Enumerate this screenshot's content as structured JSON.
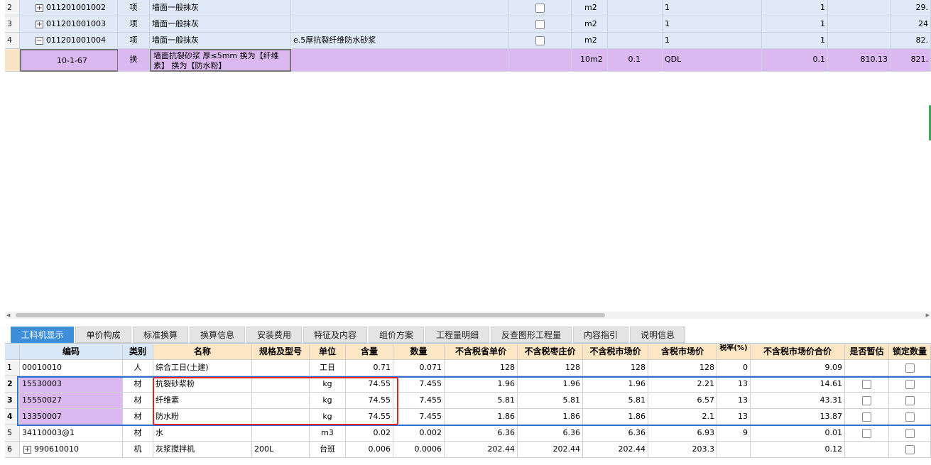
{
  "upper_grid": {
    "rows": [
      {
        "num": "2",
        "code": "011201001002",
        "type": "项",
        "name": "墙面一般抹灰",
        "feature": "",
        "unit": "m2",
        "qty_expr": "",
        "expr": "1",
        "qty": "1",
        "price": "",
        "total": "29."
      },
      {
        "num": "3",
        "code": "011201001003",
        "type": "项",
        "name": "墙面一般抹灰",
        "feature": "",
        "unit": "m2",
        "qty_expr": "",
        "expr": "1",
        "qty": "1",
        "price": "",
        "total": "24"
      },
      {
        "num": "4",
        "code": "011201001004",
        "type": "项",
        "name": "墙面一般抹灰",
        "feature": "e.5厚抗裂纤维防水砂浆",
        "unit": "m2",
        "qty_expr": "",
        "expr": "1",
        "qty": "1",
        "price": "",
        "total": "82."
      }
    ],
    "sub_row": {
      "code": "10-1-67",
      "type": "换",
      "name_line1": "墙面抗裂砂浆 厚≤5mm  换为【纤维",
      "name_line2": "素】 换为【防水粉】",
      "unit": "10m2",
      "qty_expr": "0.1",
      "expr": "QDL",
      "qty": "0.1",
      "price": "810.13",
      "total": "821."
    }
  },
  "tabs": [
    "工料机显示",
    "单价构成",
    "标准换算",
    "换算信息",
    "安装费用",
    "特征及内容",
    "组价方案",
    "工程量明细",
    "反查图形工程量",
    "内容指引",
    "说明信息"
  ],
  "lower_grid": {
    "headers": [
      "编码",
      "类别",
      "名称",
      "规格及型号",
      "单位",
      "含量",
      "数量",
      "不含税省单价",
      "不含税枣庄价",
      "不含税市场价",
      "含税市场价",
      "税率(%)",
      "不含税市场价合价",
      "是否暂估",
      "锁定数量"
    ],
    "rows": [
      {
        "num": "1",
        "code": "00010010",
        "type": "人",
        "name": "综合工日(土建)",
        "spec": "",
        "unit": "工日",
        "content": "0.71",
        "qty": "0.071",
        "p1": "128",
        "p2": "128",
        "p3": "128",
        "p4": "128",
        "tax": "0",
        "sum": "9.09"
      },
      {
        "num": "2",
        "code": "15530003",
        "type": "材",
        "name": "抗裂砂浆粉",
        "spec": "",
        "unit": "kg",
        "content": "74.55",
        "qty": "7.455",
        "p1": "1.96",
        "p2": "1.96",
        "p3": "1.96",
        "p4": "2.21",
        "tax": "13",
        "sum": "14.61"
      },
      {
        "num": "3",
        "code": "15550027",
        "type": "材",
        "name": "纤维素",
        "spec": "",
        "unit": "kg",
        "content": "74.55",
        "qty": "7.455",
        "p1": "5.81",
        "p2": "5.81",
        "p3": "5.81",
        "p4": "6.57",
        "tax": "13",
        "sum": "43.31"
      },
      {
        "num": "4",
        "code": "13350007",
        "type": "材",
        "name": "防水粉",
        "spec": "",
        "unit": "kg",
        "content": "74.55",
        "qty": "7.455",
        "p1": "1.86",
        "p2": "1.86",
        "p3": "1.86",
        "p4": "2.1",
        "tax": "13",
        "sum": "13.87"
      },
      {
        "num": "5",
        "code": "34110003@1",
        "type": "材",
        "name": "水",
        "spec": "",
        "unit": "m3",
        "content": "0.02",
        "qty": "0.002",
        "p1": "6.36",
        "p2": "6.36",
        "p3": "6.36",
        "p4": "6.93",
        "tax": "9",
        "sum": "0.01"
      },
      {
        "num": "6",
        "code": "990610010",
        "type": "机",
        "name": "灰浆搅拌机",
        "spec": "200L",
        "unit": "台班",
        "content": "0.006",
        "qty": "0.0006",
        "p1": "202.44",
        "p2": "202.44",
        "p3": "202.44",
        "p4": "203.3",
        "tax": "",
        "sum": "0.12"
      }
    ]
  },
  "colors": {
    "accent": "#3d8fd9",
    "selection_purple": "#dcb8f1",
    "highlight_red": "#e02424",
    "selection_blue": "#2f6fd2"
  }
}
